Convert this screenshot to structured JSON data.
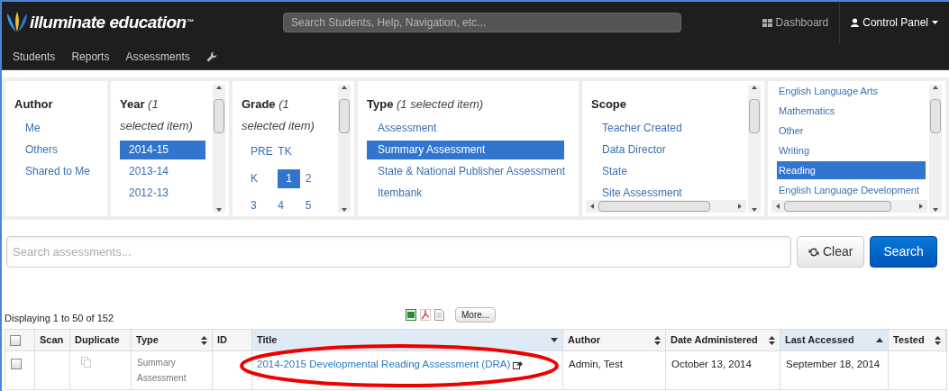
{
  "header": {
    "logo": "illuminate education",
    "logo_mark": "™",
    "search_placeholder": "Search Students, Help, Navigation, etc...",
    "links": [
      {
        "label": "Dashboard",
        "kind": "dashboard"
      },
      {
        "label": "Control Panel",
        "kind": "account"
      }
    ]
  },
  "menu": [
    "Students",
    "Reports",
    "Assessments"
  ],
  "filters": [
    {
      "title": "Author",
      "kind": "list",
      "items": [
        {
          "label": "Me",
          "selected": false
        },
        {
          "label": "Others",
          "selected": false
        },
        {
          "label": "Shared to Me",
          "selected": false
        }
      ]
    },
    {
      "title": "Year",
      "subtitle": "(1 selected item)",
      "kind": "list",
      "items": [
        {
          "label": "2014-15",
          "selected": true
        },
        {
          "label": "2013-14",
          "selected": false
        },
        {
          "label": "2012-13",
          "selected": false
        }
      ]
    },
    {
      "title": "Grade",
      "subtitle": "(1 selected item)",
      "kind": "grid",
      "rows": [
        [
          {
            "label": "PRE",
            "selected": false
          },
          {
            "label": "TK",
            "selected": false
          }
        ],
        [
          {
            "label": "K",
            "selected": false
          },
          {
            "label": "1",
            "selected": true
          },
          {
            "label": "2",
            "selected": false
          }
        ],
        [
          {
            "label": "3",
            "selected": false
          },
          {
            "label": "4",
            "selected": false
          },
          {
            "label": "5",
            "selected": false
          }
        ]
      ]
    },
    {
      "title": "Type",
      "subtitle": "(1 selected item)",
      "kind": "list",
      "items": [
        {
          "label": "Assessment",
          "selected": false
        },
        {
          "label": "Summary Assessment",
          "selected": true
        },
        {
          "label": "State & National Publisher Assessment",
          "selected": false
        },
        {
          "label": "Itembank",
          "selected": false
        }
      ]
    },
    {
      "title": "Scope",
      "kind": "list",
      "items": [
        {
          "label": "Teacher Created",
          "selected": false
        },
        {
          "label": "Data Director",
          "selected": false
        },
        {
          "label": "State",
          "selected": false
        },
        {
          "label": "Site Assessment",
          "selected": false
        }
      ]
    },
    {
      "kind": "scrolled",
      "items": [
        {
          "label": "English Language Arts",
          "selected": false
        },
        {
          "label": "Mathematics",
          "selected": false
        },
        {
          "label": "Other",
          "selected": false
        },
        {
          "label": "Writing",
          "selected": false
        },
        {
          "label": "Reading",
          "selected": true
        },
        {
          "label": "English Language Development",
          "selected": false
        }
      ]
    }
  ],
  "search": {
    "placeholder": "Search assessments...",
    "clear": "Clear",
    "submit": "Search"
  },
  "results": {
    "summary": "Displaying 1 to 50 of 152",
    "more": "More...",
    "columns": [
      {
        "selected": false,
        "kind": "checkbox"
      },
      {
        "label": "Scan",
        "selected": false,
        "kind": "plain"
      },
      {
        "label": "Duplicate",
        "selected": false,
        "kind": "plain"
      },
      {
        "label": "Type",
        "selected": false,
        "kind": "sortable"
      },
      {
        "label": "ID",
        "selected": false,
        "kind": "plain"
      },
      {
        "label": "Title",
        "selected": true,
        "kind": "descending"
      },
      {
        "label": "Author",
        "selected": false,
        "kind": "sortable"
      },
      {
        "label": "Date Administered",
        "selected": false,
        "kind": "sortable"
      },
      {
        "label": "Last Accessed",
        "selected": true,
        "kind": "ascending"
      },
      {
        "label": "Tested",
        "selected": false,
        "kind": "sortable"
      }
    ],
    "rows": [
      {
        "checked": false,
        "type": "Summary Assessment",
        "title": "2014-2015 Developmental Reading Assessment (DRA)",
        "author": "Admin, Test",
        "date_administered": "October 13, 2014",
        "last_accessed": "September 18, 2014"
      }
    ]
  }
}
